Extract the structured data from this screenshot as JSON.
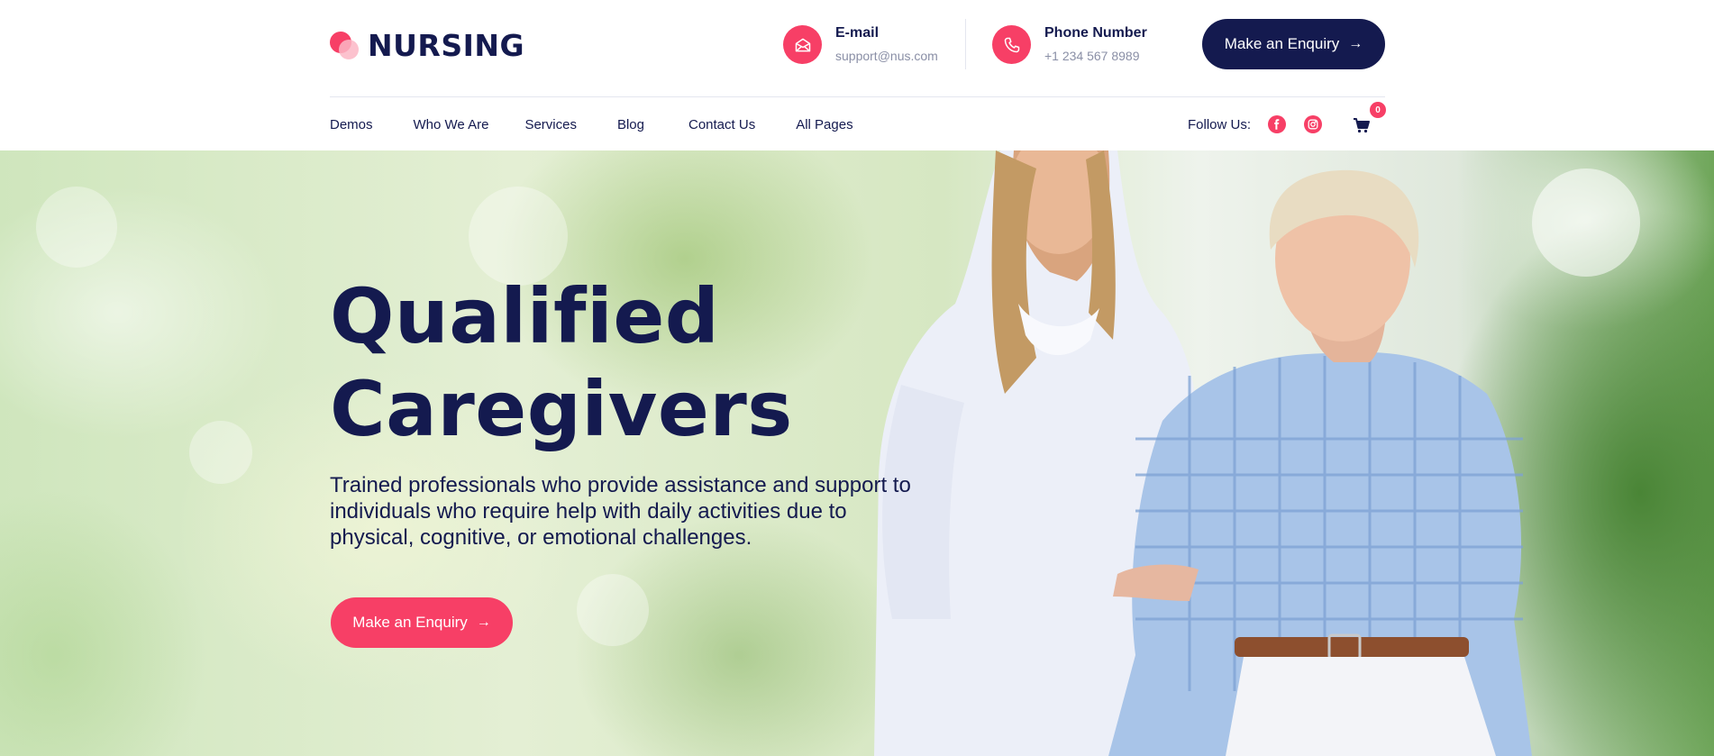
{
  "brand": {
    "name": "NURSING",
    "accent": "#f73f66",
    "navy": "#141a4f"
  },
  "contacts": {
    "email": {
      "label": "E-mail",
      "value": "support@nus.com",
      "icon": "envelope-icon"
    },
    "phone": {
      "label": "Phone Number",
      "value": "+1 234 567 8989",
      "icon": "phone-icon"
    }
  },
  "header": {
    "cta_label": "Make an Enquiry",
    "cta_icon": "arrow-right-icon"
  },
  "nav": {
    "items": [
      {
        "label": "Demos"
      },
      {
        "label": "Who We Are"
      },
      {
        "label": "Services"
      },
      {
        "label": "Blog"
      },
      {
        "label": "Contact Us"
      },
      {
        "label": "All Pages"
      }
    ],
    "follow_label": "Follow Us:",
    "social": [
      {
        "icon": "facebook-icon"
      },
      {
        "icon": "instagram-icon"
      }
    ],
    "cart": {
      "icon": "cart-icon",
      "count": "0"
    }
  },
  "hero": {
    "title_line1": "Qualified",
    "title_line2": "Caregivers",
    "subtitle": "Trained professionals who provide assistance and support to individuals who require help with daily activities due to physical, cognitive, or emotional challenges.",
    "cta_label": "Make an Enquiry",
    "cta_icon": "arrow-right-icon"
  }
}
